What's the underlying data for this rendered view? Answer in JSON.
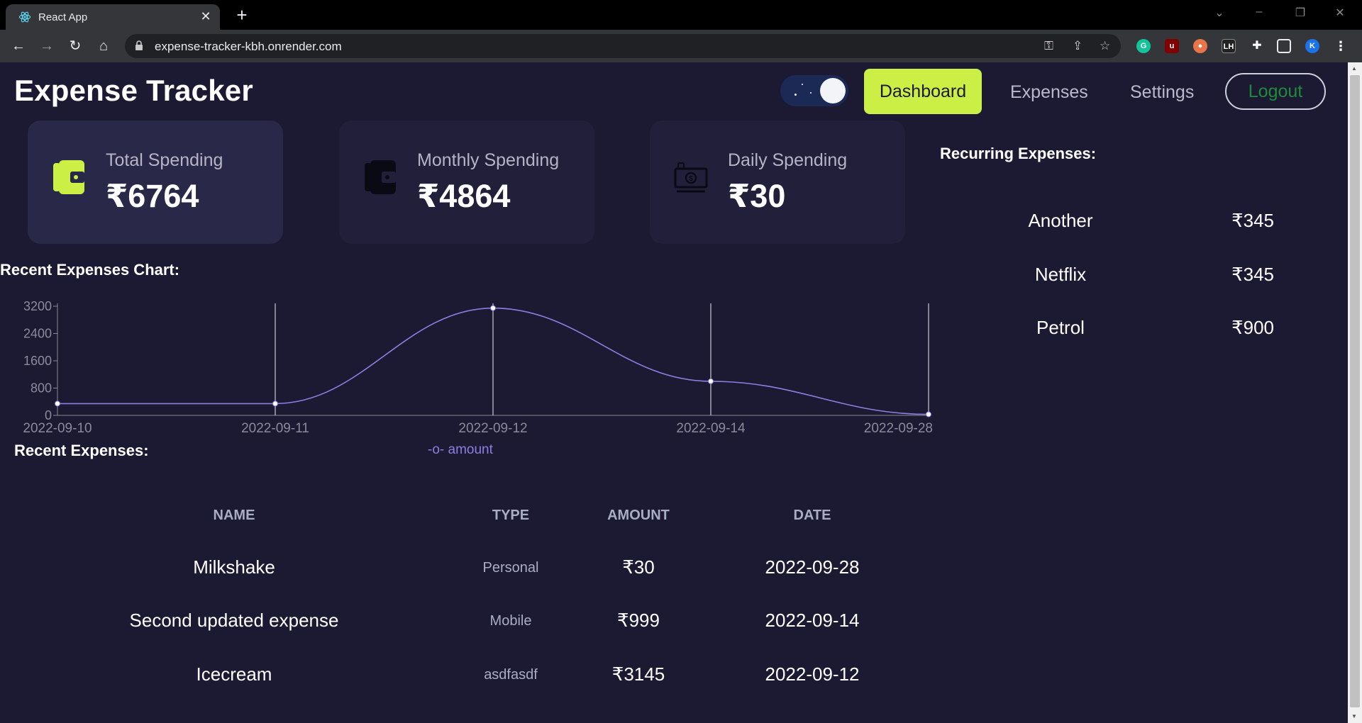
{
  "browser": {
    "tab_title": "React App",
    "url": "expense-tracker-kbh.onrender.com"
  },
  "header": {
    "brand": "Expense Tracker",
    "nav": {
      "dashboard": "Dashboard",
      "expenses": "Expenses",
      "settings": "Settings",
      "logout": "Logout"
    }
  },
  "cards": [
    {
      "label": "Total Spending",
      "value": "₹6764"
    },
    {
      "label": "Monthly Spending",
      "value": "₹4864"
    },
    {
      "label": "Daily Spending",
      "value": "₹30"
    }
  ],
  "recurring": {
    "title": "Recurring Expenses:",
    "items": [
      {
        "name": "Another",
        "amount": "₹345"
      },
      {
        "name": "Netflix",
        "amount": "₹345"
      },
      {
        "name": "Petrol",
        "amount": "₹900"
      }
    ]
  },
  "chart_section": {
    "title": "Recent Expenses Chart:"
  },
  "chart_data": {
    "type": "line",
    "x": [
      "2022-09-10",
      "2022-09-11",
      "2022-09-12",
      "2022-09-14",
      "2022-09-28"
    ],
    "series": [
      {
        "name": "amount",
        "values": [
          345,
          345,
          3145,
          999,
          30
        ]
      }
    ],
    "yticks": [
      0,
      800,
      1600,
      2400,
      3200
    ],
    "ylim": [
      0,
      3200
    ],
    "legend": "bottom",
    "color": "#8b7fe0"
  },
  "recent": {
    "title": "Recent Expenses:",
    "columns": [
      "NAME",
      "TYPE",
      "AMOUNT",
      "DATE"
    ],
    "rows": [
      {
        "name": "Milkshake",
        "type": "Personal",
        "amount": "₹30",
        "date": "2022-09-28"
      },
      {
        "name": "Second updated expense",
        "type": "Mobile",
        "amount": "₹999",
        "date": "2022-09-14"
      },
      {
        "name": "Icecream",
        "type": "asdfasdf",
        "amount": "₹3145",
        "date": "2022-09-12"
      }
    ]
  },
  "colors": {
    "background": "#1c1a33",
    "accent": "#cbef44",
    "line": "#8b7fe0",
    "logout": "#1f8a3a"
  }
}
